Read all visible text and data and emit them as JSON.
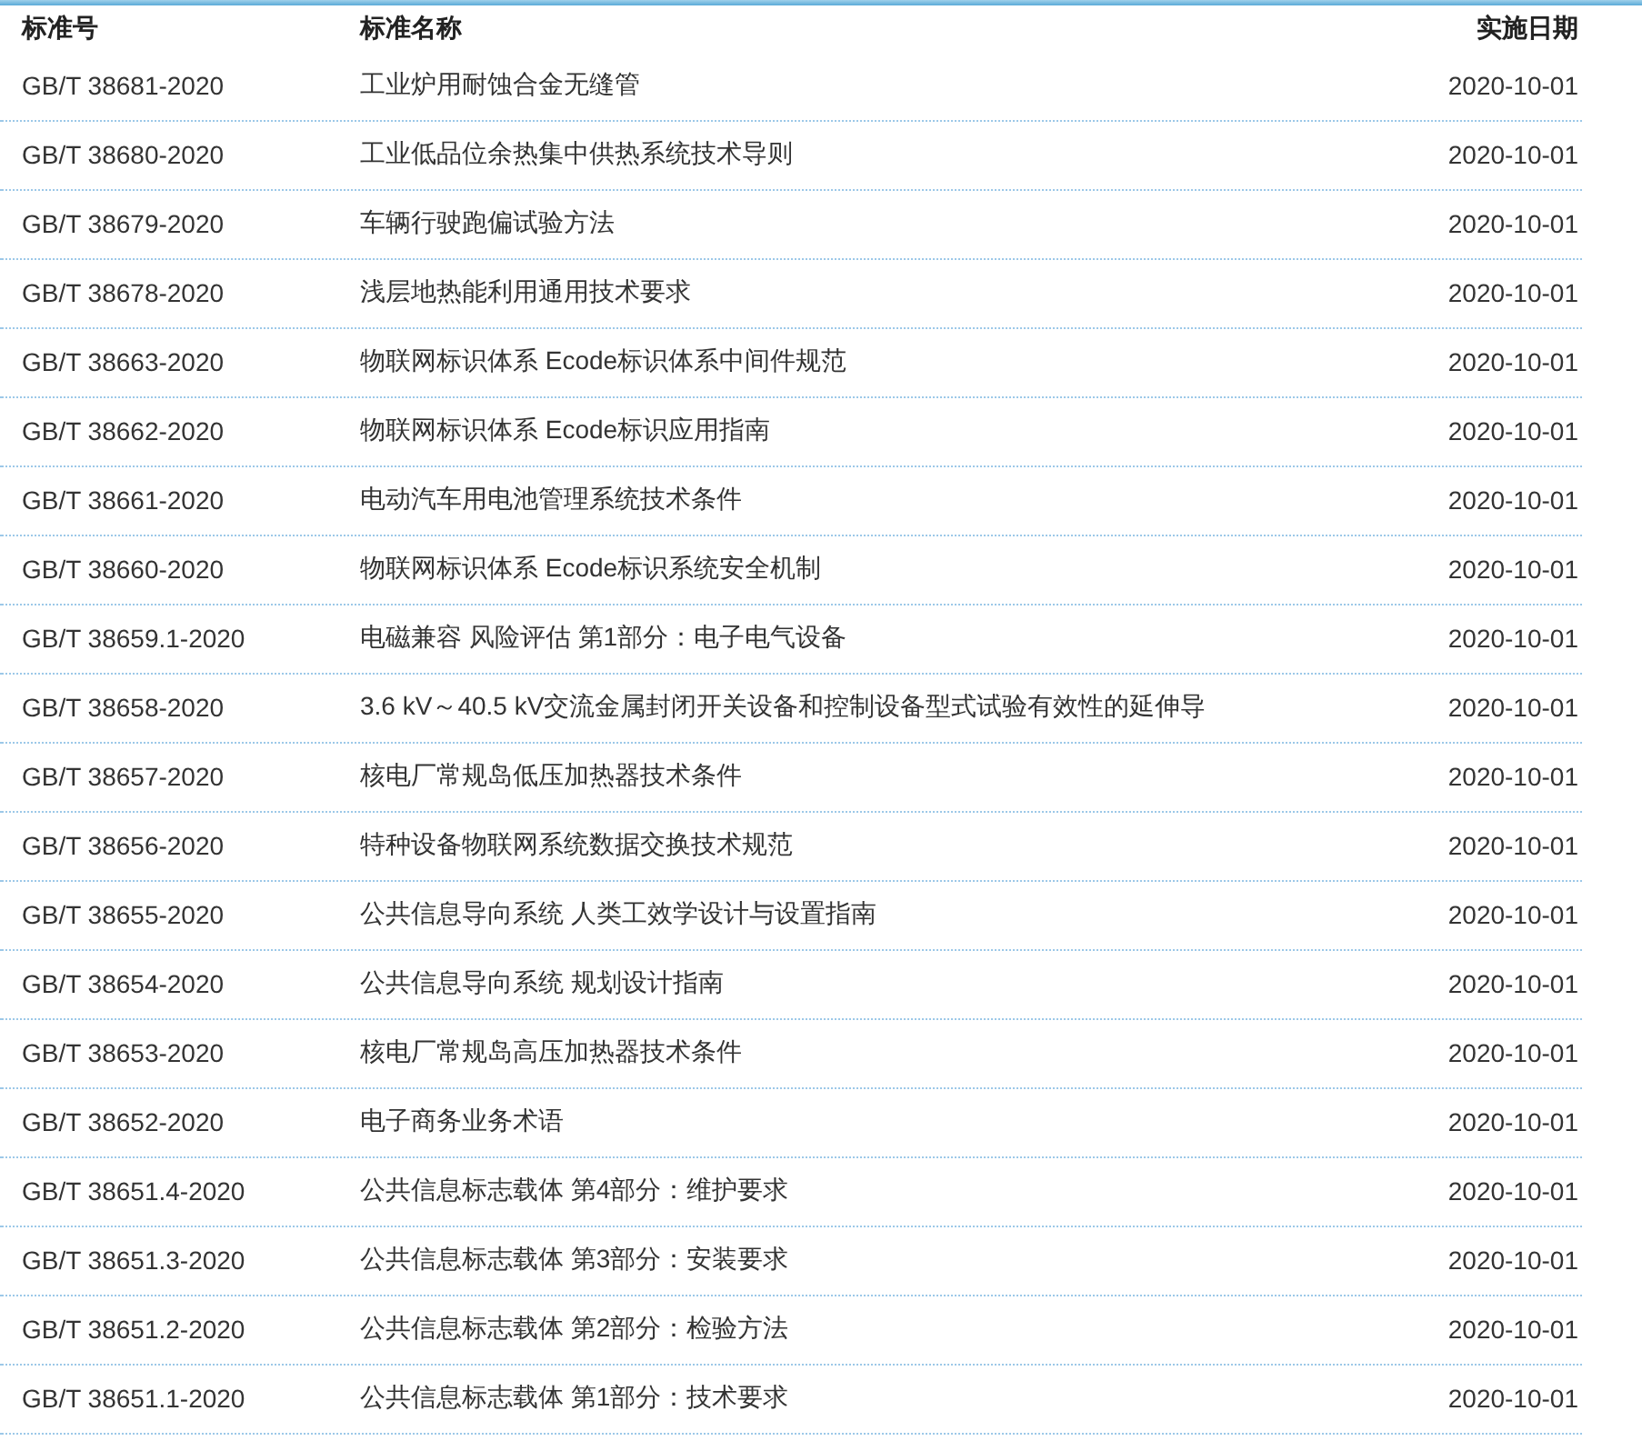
{
  "table": {
    "columns": [
      "标准号",
      "标准名称",
      "实施日期"
    ],
    "rows": [
      {
        "code": "GB/T 38681-2020",
        "name": "工业炉用耐蚀合金无缝管",
        "date": "2020-10-01"
      },
      {
        "code": "GB/T 38680-2020",
        "name": "工业低品位余热集中供热系统技术导则",
        "date": "2020-10-01"
      },
      {
        "code": "GB/T 38679-2020",
        "name": "车辆行驶跑偏试验方法",
        "date": "2020-10-01"
      },
      {
        "code": "GB/T 38678-2020",
        "name": "浅层地热能利用通用技术要求",
        "date": "2020-10-01"
      },
      {
        "code": "GB/T 38663-2020",
        "name": "物联网标识体系 Ecode标识体系中间件规范",
        "date": "2020-10-01"
      },
      {
        "code": "GB/T 38662-2020",
        "name": "物联网标识体系 Ecode标识应用指南",
        "date": "2020-10-01"
      },
      {
        "code": "GB/T 38661-2020",
        "name": "电动汽车用电池管理系统技术条件",
        "date": "2020-10-01"
      },
      {
        "code": "GB/T 38660-2020",
        "name": "物联网标识体系 Ecode标识系统安全机制",
        "date": "2020-10-01"
      },
      {
        "code": "GB/T 38659.1-2020",
        "name": "电磁兼容 风险评估 第1部分：电子电气设备",
        "date": "2020-10-01"
      },
      {
        "code": "GB/T 38658-2020",
        "name": "3.6 kV～40.5 kV交流金属封闭开关设备和控制设备型式试验有效性的延伸导",
        "date": "2020-10-01"
      },
      {
        "code": "GB/T 38657-2020",
        "name": "核电厂常规岛低压加热器技术条件",
        "date": "2020-10-01"
      },
      {
        "code": "GB/T 38656-2020",
        "name": "特种设备物联网系统数据交换技术规范",
        "date": "2020-10-01"
      },
      {
        "code": "GB/T 38655-2020",
        "name": "公共信息导向系统 人类工效学设计与设置指南",
        "date": "2020-10-01"
      },
      {
        "code": "GB/T 38654-2020",
        "name": "公共信息导向系统 规划设计指南",
        "date": "2020-10-01"
      },
      {
        "code": "GB/T 38653-2020",
        "name": "核电厂常规岛高压加热器技术条件",
        "date": "2020-10-01"
      },
      {
        "code": "GB/T 38652-2020",
        "name": "电子商务业务术语",
        "date": "2020-10-01"
      },
      {
        "code": "GB/T 38651.4-2020",
        "name": "公共信息标志载体 第4部分：维护要求",
        "date": "2020-10-01"
      },
      {
        "code": "GB/T 38651.3-2020",
        "name": "公共信息标志载体 第3部分：安装要求",
        "date": "2020-10-01"
      },
      {
        "code": "GB/T 38651.2-2020",
        "name": "公共信息标志载体 第2部分：检验方法",
        "date": "2020-10-01"
      },
      {
        "code": "GB/T 38651.1-2020",
        "name": "公共信息标志载体 第1部分：技术要求",
        "date": "2020-10-01"
      }
    ]
  }
}
